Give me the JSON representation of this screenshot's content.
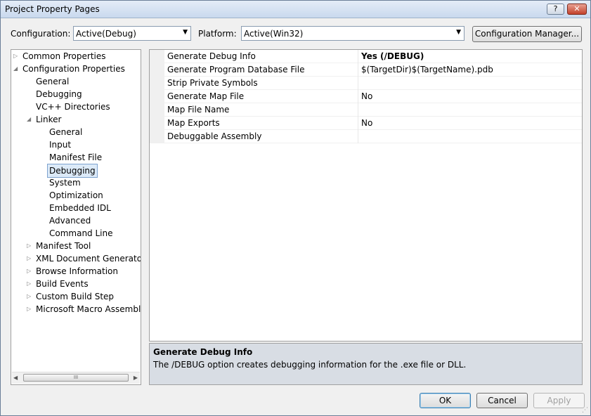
{
  "window": {
    "title": "Project Property Pages",
    "help_glyph": "?",
    "close_glyph": "✕"
  },
  "toolbar": {
    "configuration_label": "Configuration:",
    "configuration_value": "Active(Debug)",
    "platform_label": "Platform:",
    "platform_value": "Active(Win32)",
    "config_manager_label": "Configuration Manager..."
  },
  "tree": {
    "items": [
      {
        "label": "Common Properties",
        "expander": "▷"
      },
      {
        "label": "Configuration Properties",
        "expander": "◢"
      },
      {
        "label": "General",
        "expander": ""
      },
      {
        "label": "Debugging",
        "expander": ""
      },
      {
        "label": "VC++ Directories",
        "expander": ""
      },
      {
        "label": "Linker",
        "expander": "◢"
      },
      {
        "label": "General",
        "expander": ""
      },
      {
        "label": "Input",
        "expander": ""
      },
      {
        "label": "Manifest File",
        "expander": ""
      },
      {
        "label": "Debugging",
        "expander": "",
        "selected": true
      },
      {
        "label": "System",
        "expander": ""
      },
      {
        "label": "Optimization",
        "expander": ""
      },
      {
        "label": "Embedded IDL",
        "expander": ""
      },
      {
        "label": "Advanced",
        "expander": ""
      },
      {
        "label": "Command Line",
        "expander": ""
      },
      {
        "label": "Manifest Tool",
        "expander": "▷"
      },
      {
        "label": "XML Document Generator",
        "expander": "▷"
      },
      {
        "label": "Browse Information",
        "expander": "▷"
      },
      {
        "label": "Build Events",
        "expander": "▷"
      },
      {
        "label": "Custom Build Step",
        "expander": "▷"
      },
      {
        "label": "Microsoft Macro Assembler",
        "expander": "▷"
      }
    ],
    "scroll_left": "◀",
    "scroll_right": "▶",
    "scroll_thumb": "III"
  },
  "properties": [
    {
      "name": "Generate Debug Info",
      "value": "Yes (/DEBUG)",
      "bold": true
    },
    {
      "name": "Generate Program Database File",
      "value": "$(TargetDir)$(TargetName).pdb"
    },
    {
      "name": "Strip Private Symbols",
      "value": ""
    },
    {
      "name": "Generate Map File",
      "value": "No"
    },
    {
      "name": "Map File Name",
      "value": ""
    },
    {
      "name": "Map Exports",
      "value": "No"
    },
    {
      "name": "Debuggable Assembly",
      "value": ""
    }
  ],
  "description": {
    "title": "Generate Debug Info",
    "text": "The /DEBUG option creates debugging information for the .exe file or DLL."
  },
  "buttons": {
    "ok": "OK",
    "cancel": "Cancel",
    "apply": "Apply"
  },
  "icons": {
    "dropdown_arrow": "▼",
    "resize_grip": "⋰"
  }
}
